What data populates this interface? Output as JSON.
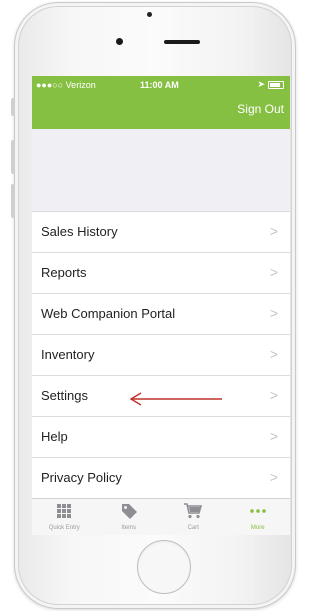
{
  "status_bar": {
    "carrier": "●●●○○ Verizon",
    "time": "11:00 AM"
  },
  "nav_bar": {
    "sign_out_label": "Sign Out"
  },
  "menu": {
    "items": [
      {
        "label": "Sales History"
      },
      {
        "label": "Reports"
      },
      {
        "label": "Web Companion Portal"
      },
      {
        "label": "Inventory"
      },
      {
        "label": "Settings"
      },
      {
        "label": "Help"
      },
      {
        "label": "Privacy Policy"
      }
    ],
    "chevron": ">"
  },
  "tab_bar": {
    "tabs": [
      {
        "label": "Quick Entry",
        "icon": "grid-icon"
      },
      {
        "label": "Items",
        "icon": "tag-icon"
      },
      {
        "label": "Cart",
        "icon": "cart-icon"
      },
      {
        "label": "More",
        "icon": "more-icon",
        "active": true
      }
    ]
  },
  "colors": {
    "accent_green": "#86c043",
    "annotation_arrow": "#c0302c"
  }
}
